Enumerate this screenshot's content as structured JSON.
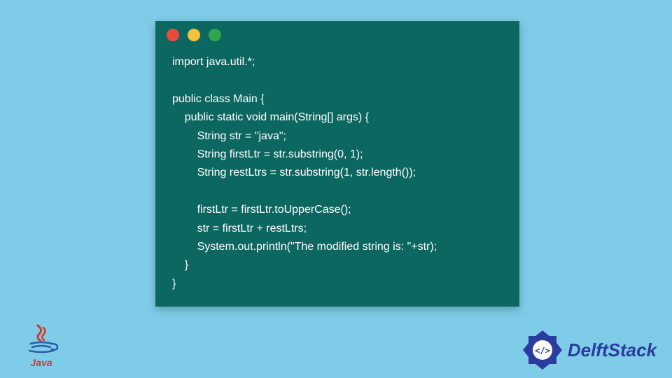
{
  "codeWindow": {
    "dots": [
      "red",
      "yellow",
      "green"
    ],
    "code": "import java.util.*;\n\npublic class Main {\n    public static void main(String[] args) {\n        String str = \"java\";\n        String firstLtr = str.substring(0, 1);\n        String restLtrs = str.substring(1, str.length());\n\n        firstLtr = firstLtr.toUpperCase();\n        str = firstLtr + restLtrs;\n        System.out.println(\"The modified string is: \"+str);\n    }\n}"
  },
  "javaLogo": {
    "label": "Java"
  },
  "delft": {
    "text": "DelftStack"
  }
}
